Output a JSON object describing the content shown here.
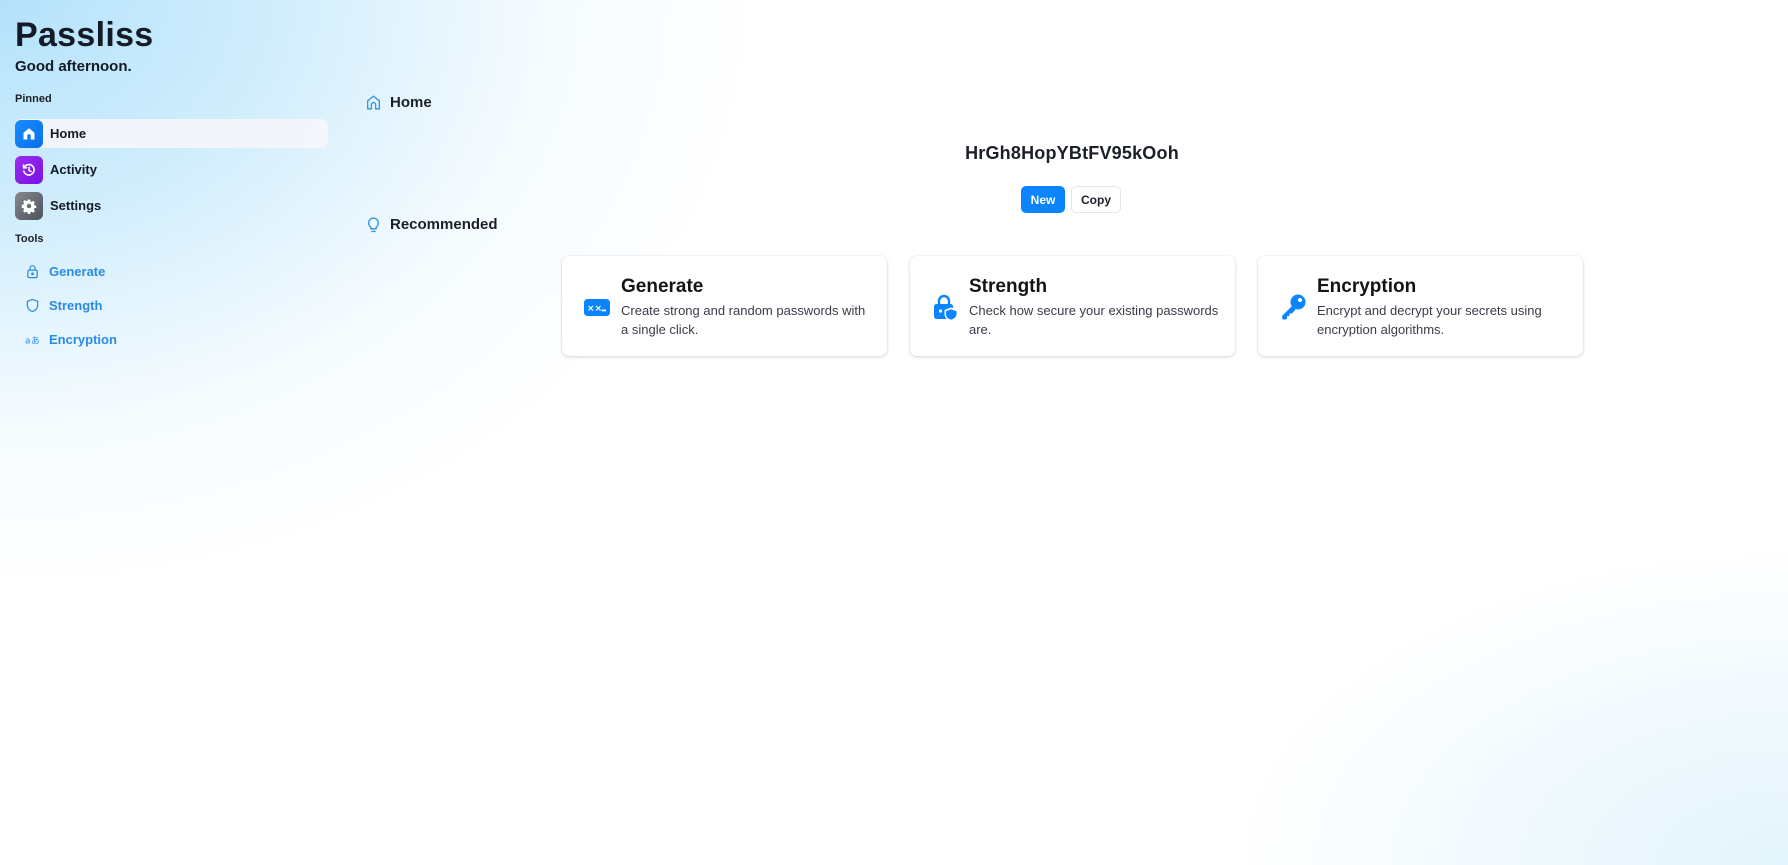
{
  "app": {
    "title": "Passliss",
    "greeting": "Good afternoon."
  },
  "sidebar": {
    "pinned_label": "Pinned",
    "pinned": [
      {
        "label": "Home",
        "icon": "home-icon",
        "color": "#0a84ff",
        "active": true
      },
      {
        "label": "Activity",
        "icon": "history-icon",
        "color": "#8a1cf0",
        "active": false
      },
      {
        "label": "Settings",
        "icon": "gear-icon",
        "color": "#6b6e76",
        "active": false
      }
    ],
    "tools_label": "Tools",
    "tools": [
      {
        "label": "Generate",
        "icon": "lock-icon"
      },
      {
        "label": "Strength",
        "icon": "shield-icon"
      },
      {
        "label": "Encryption",
        "icon": "translate-icon"
      }
    ]
  },
  "main": {
    "home_heading": "Home",
    "password": "HrGh8HopYBtFV95kOoh",
    "new_button": "New",
    "copy_button": "Copy",
    "recommended_heading": "Recommended",
    "cards": [
      {
        "title": "Generate",
        "description": "Create strong and random passwords with a single click.",
        "icon": "password-icon"
      },
      {
        "title": "Strength",
        "description": "Check how secure your existing passwords are.",
        "icon": "lock-shield-icon"
      },
      {
        "title": "Encryption",
        "description": "Encrypt and decrypt your secrets using encryption algorithms.",
        "icon": "key-icon"
      }
    ]
  },
  "colors": {
    "accent": "#0a84ff",
    "tool_link": "#2b8be3"
  }
}
